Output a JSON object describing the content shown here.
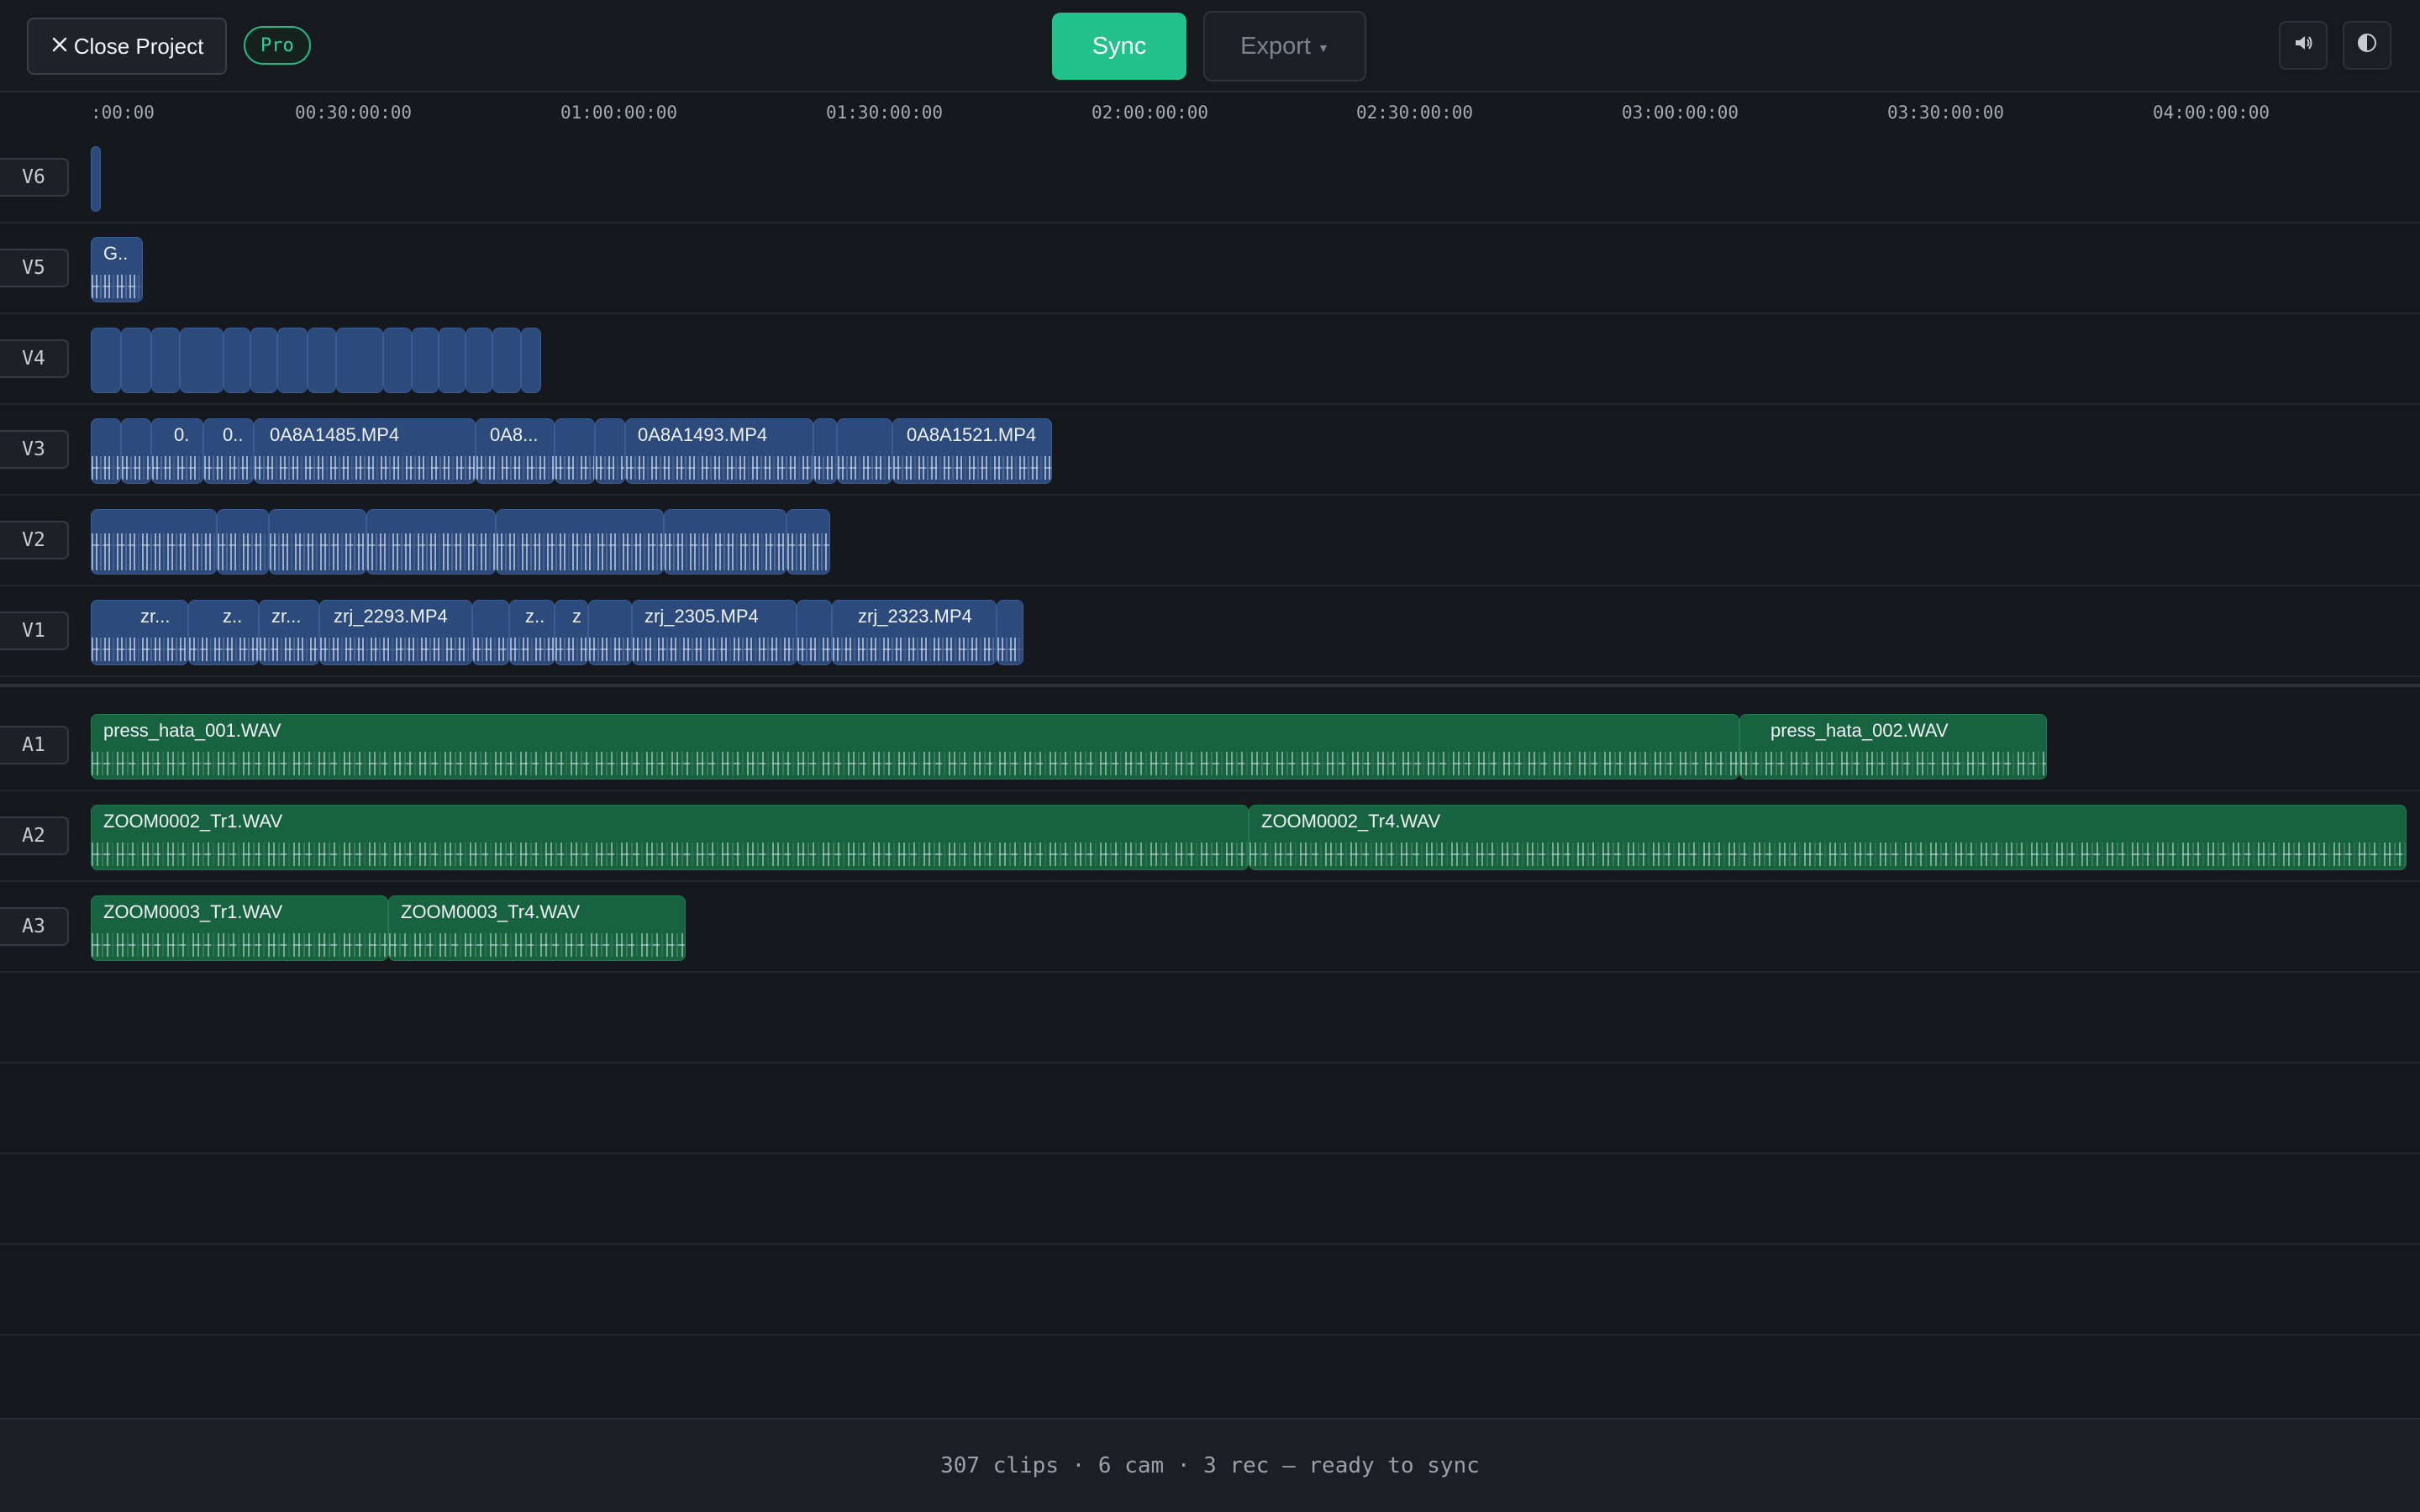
{
  "topbar": {
    "close_label": "Close Project",
    "close_icon": "x-icon",
    "pro_badge": "Pro",
    "sync_label": "Sync",
    "export_label": "Export",
    "volume_icon": "speaker-icon",
    "theme_icon": "contrast-icon"
  },
  "ruler": {
    "ticks": [
      ":00:00",
      "00:30:00:00",
      "01:00:00:00",
      "01:30:00:00",
      "02:00:00:00",
      "02:30:00:00",
      "03:00:00:00",
      "03:30:00:00",
      "04:00:00:00"
    ]
  },
  "tracks": {
    "v6": {
      "label": "V6",
      "clips": [
        ""
      ]
    },
    "v5": {
      "label": "V5",
      "clips": [
        "G.."
      ]
    },
    "v4": {
      "label": "V4",
      "clips": []
    },
    "v3": {
      "label": "V3",
      "clips": [
        "0.",
        "0..",
        "0A8A1485.MP4",
        "0A8...",
        "0A8A1493.MP4",
        "0A8A1521.MP4"
      ]
    },
    "v2": {
      "label": "V2",
      "clips": []
    },
    "v1": {
      "label": "V1",
      "clips": [
        "zr...",
        "z..",
        "zr...",
        "zrj_2293.MP4",
        "z..",
        "z",
        "zrj_2305.MP4",
        "zrj_2323.MP4"
      ]
    },
    "a1": {
      "label": "A1",
      "clips": [
        "press_hata_001.WAV",
        "press_hata_002.WAV"
      ]
    },
    "a2": {
      "label": "A2",
      "clips": [
        "ZOOM0002_Tr1.WAV",
        "ZOOM0002_Tr4.WAV"
      ]
    },
    "a3": {
      "label": "A3",
      "clips": [
        "ZOOM0003_Tr1.WAV",
        "ZOOM0003_Tr4.WAV"
      ]
    }
  },
  "status": {
    "text": "307 clips · 6 cam · 3 rec — ready to sync"
  },
  "colors": {
    "accent": "#22c08b",
    "video_clip": "#2c4a7c",
    "audio_clip": "#17623f"
  }
}
